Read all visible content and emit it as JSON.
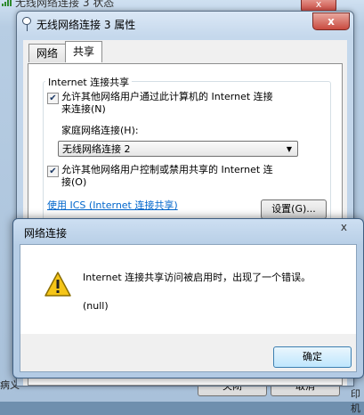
{
  "background_window": {
    "title": "无线网络连接 3 状态",
    "footer_left": "病义",
    "footer_right": "印机",
    "button_left": "关闭",
    "button_right": "取消"
  },
  "properties_dialog": {
    "title": "无线网络连接 3 属性",
    "close_symbol": "x",
    "tabs": [
      {
        "label": "网络"
      },
      {
        "label": "共享"
      }
    ],
    "group_title": "Internet 连接共享",
    "allow_connect": {
      "checked": true,
      "line1": "允许其他网络用户通过此计算机的 Internet 连接",
      "line2": "来连接(N)"
    },
    "home_network_label": "家庭网络连接(H):",
    "home_network_value": "无线网络连接 2",
    "allow_control": {
      "checked": true,
      "line1": "允许其他网络用户控制或禁用共享的 Internet 连",
      "line2": "接(O)"
    },
    "ics_link": "使用 ICS (Internet 连接共享)",
    "settings_button": "设置(G)..."
  },
  "error_dialog": {
    "title": "网络连接",
    "close_symbol": "x",
    "message": "Internet 连接共享访问被启用时，出现了一个错误。",
    "detail": "(null)",
    "ok_button": "确定"
  },
  "icons": {
    "checkmark": "✔",
    "dropdown_arrow": "▼"
  }
}
